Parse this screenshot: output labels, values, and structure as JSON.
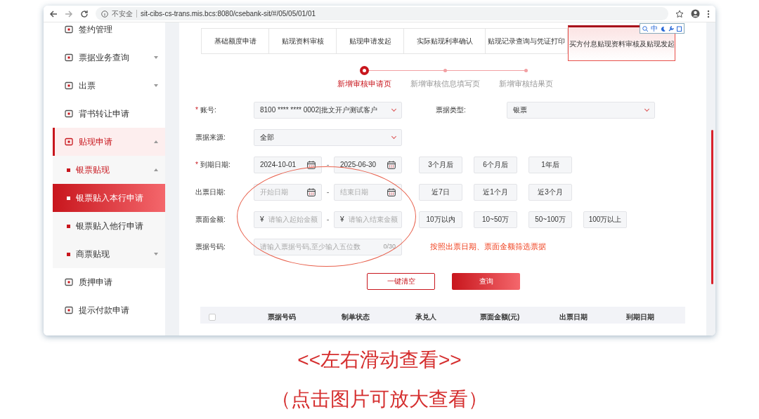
{
  "browser": {
    "security_label": "不安全",
    "url": "sit-cibs-cs-trans.mis.bcs:8080/csebank-sit/#/05/05/01/01",
    "extension_text": "中"
  },
  "sidebar": {
    "items": [
      {
        "label": "签约管理",
        "selected": false
      },
      {
        "label": "票据业务查询",
        "selected": false,
        "expanded": false
      },
      {
        "label": "出票",
        "selected": false,
        "expanded": false
      },
      {
        "label": "背书转让申请",
        "selected": false
      },
      {
        "label": "贴现申请",
        "selected": true,
        "expanded": true,
        "children": [
          {
            "label": "银票贴现",
            "selected": true,
            "expanded": true,
            "children": [
              {
                "label": "银票贴入本行申请",
                "selected": true
              },
              {
                "label": "银票贴入他行申请",
                "selected": false
              }
            ]
          },
          {
            "label": "商票贴现",
            "selected": false,
            "expanded": false
          }
        ]
      },
      {
        "label": "质押申请",
        "selected": false
      },
      {
        "label": "提示付款申请",
        "selected": false
      }
    ]
  },
  "tabs": [
    {
      "label": "基础额度申请",
      "selected": false
    },
    {
      "label": "贴现资料审核",
      "selected": false
    },
    {
      "label": "贴现申请发起",
      "selected": false
    },
    {
      "label": "实际贴现利率确认",
      "selected": false
    },
    {
      "label": "贴现记录查询与凭证打印",
      "selected": false
    },
    {
      "label": "买方付息贴现资料审核及贴现发起",
      "selected": true
    }
  ],
  "steps": [
    {
      "label": "新增审核申请页",
      "selected": true
    },
    {
      "label": "新增审核信息填写页",
      "selected": false
    },
    {
      "label": "新增审核结果页",
      "selected": false
    }
  ],
  "form": {
    "rows": [
      {
        "label": "账号:",
        "mark": "*",
        "items": [
          {
            "kind": "select",
            "value": "8100 **** **** 0002|批文开户测试客户"
          },
          {
            "kind": "field-label",
            "label": "票据类型:"
          },
          {
            "kind": "select",
            "value": "银票"
          }
        ]
      },
      {
        "label": "票据来源:",
        "items": [
          {
            "kind": "select",
            "value": "全部"
          }
        ]
      },
      {
        "label": "到期日期:",
        "mark": "*",
        "items": [
          {
            "kind": "date",
            "value": "2024-10-01"
          },
          {
            "kind": "dash",
            "text": "-"
          },
          {
            "kind": "date",
            "value": "2025-06-30"
          },
          {
            "kind": "quick",
            "text": "3个月后"
          },
          {
            "kind": "quick",
            "text": "6个月后"
          },
          {
            "kind": "quick",
            "text": "1年后"
          }
        ]
      },
      {
        "label": "出票日期:",
        "items": [
          {
            "kind": "date",
            "placeholder": "开始日期"
          },
          {
            "kind": "dash",
            "text": "-"
          },
          {
            "kind": "date",
            "placeholder": "结束日期"
          },
          {
            "kind": "quick",
            "text": "近7日"
          },
          {
            "kind": "quick",
            "text": "近1个月"
          },
          {
            "kind": "quick",
            "text": "近3个月"
          }
        ]
      },
      {
        "label": "票面金额:",
        "items": [
          {
            "kind": "money",
            "prefix": "¥",
            "placeholder": "请输入起始金额"
          },
          {
            "kind": "dash",
            "text": "-"
          },
          {
            "kind": "money",
            "prefix": "¥",
            "placeholder": "请输入结束金额"
          },
          {
            "kind": "quick",
            "text": "10万以内"
          },
          {
            "kind": "quick",
            "text": "10~50万"
          },
          {
            "kind": "quick",
            "text": "50~100万"
          },
          {
            "kind": "quick",
            "text": "100万以上"
          }
        ]
      },
      {
        "label": "票据号码:",
        "items": [
          {
            "kind": "text",
            "placeholder": "请输入票据号码,至少输入五位数",
            "counter": "0/30"
          },
          {
            "kind": "note",
            "text": "按照出票日期、票面金额筛选票据"
          }
        ]
      }
    ],
    "buttons": [
      {
        "label": "一键清空",
        "kind": "outline"
      },
      {
        "label": "查询",
        "kind": "primary"
      }
    ]
  },
  "table": {
    "all_checked": false,
    "columns": [
      "票据号码",
      "制单状态",
      "承兑人",
      "票面金额(元)",
      "出票日期",
      "到期日期"
    ]
  },
  "caption": [
    "<<左右滑动查看>>",
    "（点击图片可放大查看）"
  ]
}
